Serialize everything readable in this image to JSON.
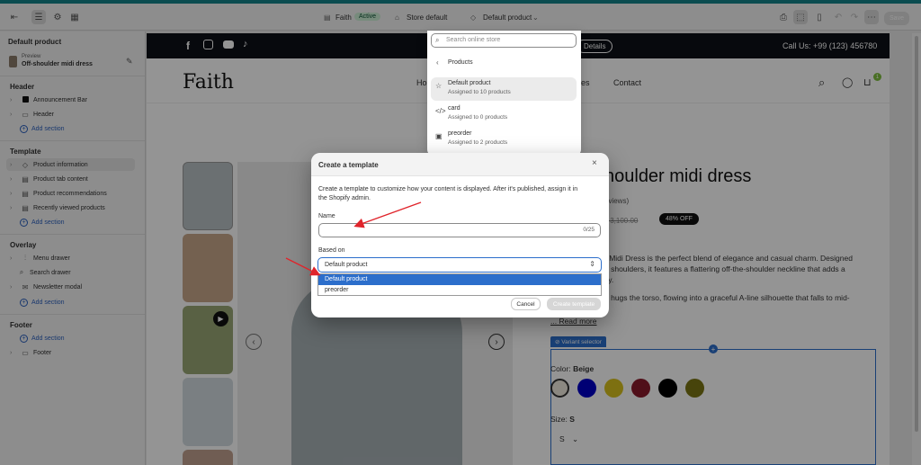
{
  "topbar": {
    "theme_name": "Faith",
    "theme_status": "Active",
    "store_label": "Store default",
    "template_label": "Default product",
    "save_label": "Save"
  },
  "sidebar": {
    "title": "Default product",
    "preview_label": "Preview",
    "preview_product": "Off-shoulder midi dress",
    "groups": [
      {
        "label": "Header",
        "items": [
          "Announcement Bar",
          "Header"
        ],
        "add": "Add section"
      },
      {
        "label": "Template",
        "items": [
          "Product information",
          "Product tab content",
          "Product recommendations",
          "Recently viewed products"
        ],
        "add": "Add section"
      },
      {
        "label": "Overlay",
        "items": [
          "Menu drawer",
          "Search drawer",
          "Newsletter modal"
        ],
        "add": "Add section"
      },
      {
        "label": "Footer",
        "items": [
          "Footer"
        ],
        "add": "Add section"
      }
    ]
  },
  "storefront": {
    "announce_button": "Details",
    "call_us": "Call Us: +99 (123) 456780",
    "logo": "Faith",
    "nav": [
      "Ho",
      "es",
      "Contact"
    ],
    "cart_count": "1",
    "product_title": "houlder midi dress",
    "reviews": "eviews)",
    "old_price": "3,100.00",
    "old_price_prefix": "k",
    "discount": "48% OFF",
    "desc_1": "r Midi Dress is the perfect blend of elegance and casual charm. Designed",
    "desc_2": "e shoulders, it features a flattering off-the-shoulder neckline that adds a",
    "desc_3": "ity.",
    "desc_4": "e hugs the torso, flowing into a graceful A-line silhouette that falls to mid-",
    "read_more": "... Read more",
    "variant_selector": "Variant selector",
    "color_label": "Color:",
    "color_value": "Beige",
    "size_label": "Size:",
    "size_value": "S",
    "size_select": "S",
    "swatches": [
      "#f0eadf",
      "#0000c8",
      "#d8c21e",
      "#8b1a2b",
      "#000000",
      "#7b7613"
    ]
  },
  "search_dropdown": {
    "placeholder": "Search online store",
    "back_label": "Products",
    "items": [
      {
        "name": "Default product",
        "sub": "Assigned to 10 products"
      },
      {
        "name": "card",
        "sub": "Assigned to 0 products"
      },
      {
        "name": "preorder",
        "sub": "Assigned to 2 products"
      }
    ]
  },
  "modal": {
    "title": "Create a template",
    "description_1": "Create a template to customize how your content is displayed. After it's published, assign it in",
    "description_2": "the Shopify admin.",
    "name_label": "Name",
    "name_value": "",
    "char_count": "0/25",
    "based_on_label": "Based on",
    "based_on_value": "Default product",
    "options": [
      "Default product",
      "preorder"
    ],
    "cancel_label": "Cancel",
    "create_label": "Create template"
  },
  "colors": {
    "accent_teal": "#14838b",
    "announce_bg": "#0d1117",
    "link_blue": "#2a5fbd",
    "select_blue": "#2c6ecb",
    "arrow_red": "#e0242b"
  }
}
